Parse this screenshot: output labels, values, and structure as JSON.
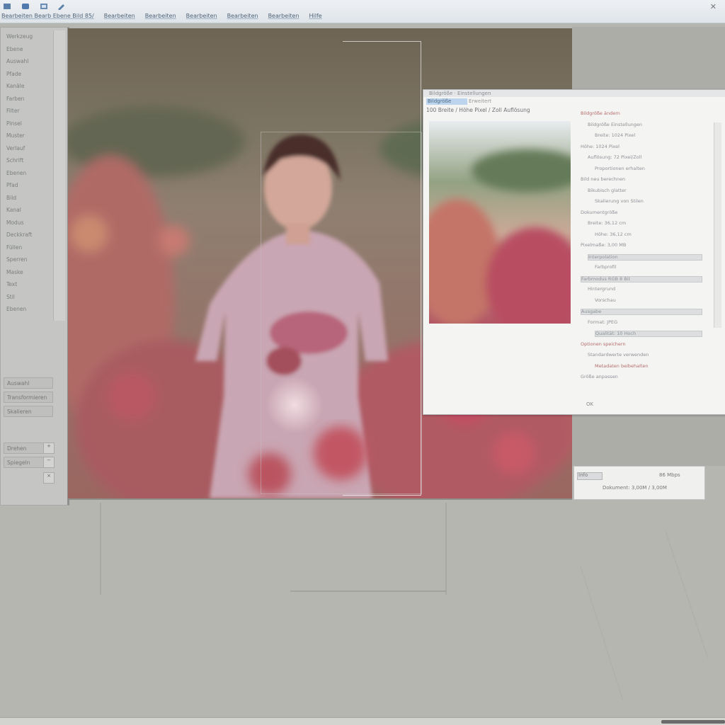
{
  "toolbar": {
    "icons": [
      "file-icon",
      "document-icon",
      "image-icon",
      "tool-icon"
    ],
    "menu": [
      {
        "label": "Bearbeiten Bearb Ebene Bild 85/"
      },
      {
        "label": "Bearbeiten"
      },
      {
        "label": "Bearbeiten"
      },
      {
        "label": "Bearbeiten"
      },
      {
        "label": "Bearbeiten"
      },
      {
        "label": "Bearbeiten"
      },
      {
        "label": "Hilfe"
      }
    ],
    "close_glyph": "✕"
  },
  "left_panel": {
    "items": [
      "Werkzeug",
      "Ebene",
      "Auswahl",
      "Pfade",
      "Kanäle",
      "Farben",
      "Filter",
      "Pinsel",
      "Muster",
      "Verlauf",
      "Schrift",
      "Ebenen",
      "Pfad",
      "Bild",
      "Kanal",
      "Modus",
      "Deckkraft",
      "Füllen",
      "Sperren",
      "Maske",
      "Text",
      "Stil",
      "Ebenen"
    ],
    "buttons": [
      "Auswahl",
      "Transformieren",
      "Skalieren",
      "Drehen",
      "Spiegeln"
    ],
    "mini_buttons": [
      "+",
      "−",
      "×"
    ]
  },
  "dialog": {
    "title_text": "Bildgröße · Einstellungen",
    "tab_active": "Bildgröße",
    "tab_text": "Erweitert",
    "field_row": "100   Breite  /   Höhe  Pixel  /  Zoll  Auflösung",
    "lines": [
      {
        "text": "Bildgröße ändern",
        "style": "red"
      },
      {
        "text": "Bildgröße Einstellungen",
        "style": ""
      },
      {
        "text": "Breite: 1024 Pixel",
        "style": ""
      },
      {
        "text": "Höhe: 1024 Pixel",
        "style": ""
      },
      {
        "text": "Auflösung: 72 Pixel/Zoll",
        "style": ""
      },
      {
        "text": "Proportionen erhalten",
        "style": ""
      },
      {
        "text": "Bild neu berechnen",
        "style": ""
      },
      {
        "text": "Bikubisch glatter",
        "style": ""
      },
      {
        "text": "Skalierung von Stilen",
        "style": ""
      },
      {
        "text": "Dokumentgröße",
        "style": ""
      },
      {
        "text": "Breite: 36,12 cm",
        "style": ""
      },
      {
        "text": "Höhe: 36,12 cm",
        "style": ""
      },
      {
        "text": "Pixelmaße: 3,00 MB",
        "style": ""
      },
      {
        "text": "Interpolation",
        "style": "box"
      },
      {
        "text": "Farbprofil",
        "style": ""
      },
      {
        "text": "Farbmodus RGB 8 Bit",
        "style": "box"
      },
      {
        "text": "Hintergrund",
        "style": ""
      },
      {
        "text": "Vorschau",
        "style": ""
      },
      {
        "text": "Ausgabe",
        "style": "box"
      },
      {
        "text": "Format: JPEG",
        "style": ""
      },
      {
        "text": "Qualität: 10 Hoch",
        "style": "box"
      },
      {
        "text": "Optionen speichern",
        "style": "red"
      },
      {
        "text": "Standardwerte verwenden",
        "style": ""
      },
      {
        "text": "Metadaten beibehalten",
        "style": "red"
      },
      {
        "text": "Größe anpassen",
        "style": ""
      }
    ],
    "footer": "OK"
  },
  "mini_dialog": {
    "label_left": "Info",
    "label_right": "86 Mbps",
    "row": "Dokument: 3,00M / 3,00M"
  },
  "colors": {
    "menu_text": "#4f6378",
    "dialog_bg": "#f4f4f2",
    "accent_tab": "#bcd4ee",
    "red_text": "#b46c6c"
  }
}
